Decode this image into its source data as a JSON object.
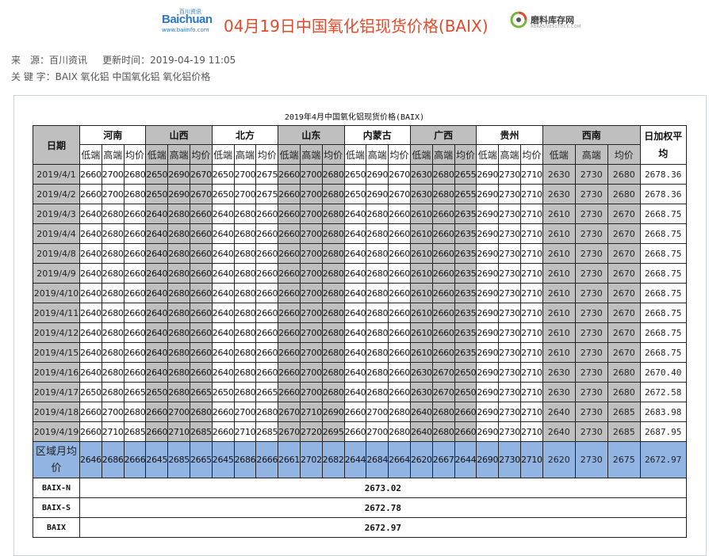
{
  "header": {
    "logo_left": {
      "brand": "Baichuan",
      "top": "百川资讯",
      "sub": "www.baiinfo.com"
    },
    "headline": "04月19日中国氧化铝现货价格(BAIX)",
    "logo_right": {
      "name": "磨料库存网",
      "sub": "ABRASIVESSTOCK.COM"
    }
  },
  "meta": {
    "source_label": "来　源：",
    "source_value": "百川资讯",
    "update_label": "更新时间：",
    "update_value": "2019-04-19 11:05",
    "keywords_label": "关 键 字：",
    "keywords_value": "BAIX 氧化铝 中国氧化铝 氧化铝价格"
  },
  "table": {
    "caption": "2019年4月中国氧化铝现货价格(BAIX)",
    "date_header": "日期",
    "avg_header": "日加权平均",
    "regions": [
      "河南",
      "山西",
      "北方",
      "山东",
      "内蒙古",
      "广西",
      "贵州",
      "西南"
    ],
    "sub_headers": [
      "低端",
      "高端",
      "均价"
    ],
    "rows": [
      {
        "date": "2019/4/1",
        "v": [
          "2660",
          "2700",
          "2680",
          "2650",
          "2690",
          "2670",
          "2650",
          "2700",
          "2675",
          "2660",
          "2700",
          "2680",
          "2650",
          "2690",
          "2670",
          "2630",
          "2680",
          "2655",
          "2690",
          "2730",
          "2710",
          "2630",
          "2730",
          "2680"
        ],
        "avg": "2678.36"
      },
      {
        "date": "2019/4/2",
        "v": [
          "2660",
          "2700",
          "2680",
          "2650",
          "2690",
          "2670",
          "2650",
          "2700",
          "2675",
          "2660",
          "2700",
          "2680",
          "2650",
          "2690",
          "2670",
          "2630",
          "2680",
          "2655",
          "2690",
          "2730",
          "2710",
          "2630",
          "2730",
          "2680"
        ],
        "avg": "2678.36"
      },
      {
        "date": "2019/4/3",
        "v": [
          "2640",
          "2680",
          "2660",
          "2640",
          "2680",
          "2660",
          "2640",
          "2680",
          "2660",
          "2660",
          "2700",
          "2680",
          "2640",
          "2680",
          "2660",
          "2610",
          "2660",
          "2635",
          "2690",
          "2730",
          "2710",
          "2610",
          "2730",
          "2670"
        ],
        "avg": "2668.75"
      },
      {
        "date": "2019/4/4",
        "v": [
          "2640",
          "2680",
          "2660",
          "2640",
          "2680",
          "2660",
          "2640",
          "2680",
          "2660",
          "2660",
          "2700",
          "2680",
          "2640",
          "2680",
          "2660",
          "2610",
          "2660",
          "2635",
          "2690",
          "2730",
          "2710",
          "2610",
          "2730",
          "2670"
        ],
        "avg": "2668.75"
      },
      {
        "date": "2019/4/8",
        "v": [
          "2640",
          "2680",
          "2660",
          "2640",
          "2680",
          "2660",
          "2640",
          "2680",
          "2660",
          "2660",
          "2700",
          "2680",
          "2640",
          "2680",
          "2660",
          "2610",
          "2660",
          "2635",
          "2690",
          "2730",
          "2710",
          "2610",
          "2730",
          "2670"
        ],
        "avg": "2668.75"
      },
      {
        "date": "2019/4/9",
        "v": [
          "2640",
          "2680",
          "2660",
          "2640",
          "2680",
          "2660",
          "2640",
          "2680",
          "2660",
          "2660",
          "2700",
          "2680",
          "2640",
          "2680",
          "2660",
          "2610",
          "2660",
          "2635",
          "2690",
          "2730",
          "2710",
          "2610",
          "2730",
          "2670"
        ],
        "avg": "2668.75"
      },
      {
        "date": "2019/4/10",
        "v": [
          "2640",
          "2680",
          "2660",
          "2640",
          "2680",
          "2660",
          "2640",
          "2680",
          "2660",
          "2660",
          "2700",
          "2680",
          "2640",
          "2680",
          "2660",
          "2610",
          "2660",
          "2635",
          "2690",
          "2730",
          "2710",
          "2610",
          "2730",
          "2670"
        ],
        "avg": "2668.75"
      },
      {
        "date": "2019/4/11",
        "v": [
          "2640",
          "2680",
          "2660",
          "2640",
          "2680",
          "2660",
          "2640",
          "2680",
          "2660",
          "2660",
          "2700",
          "2680",
          "2640",
          "2680",
          "2660",
          "2610",
          "2660",
          "2635",
          "2690",
          "2730",
          "2710",
          "2610",
          "2730",
          "2670"
        ],
        "avg": "2668.75"
      },
      {
        "date": "2019/4/12",
        "v": [
          "2640",
          "2680",
          "2660",
          "2640",
          "2680",
          "2660",
          "2640",
          "2680",
          "2660",
          "2660",
          "2700",
          "2680",
          "2640",
          "2680",
          "2660",
          "2610",
          "2660",
          "2635",
          "2690",
          "2730",
          "2710",
          "2610",
          "2730",
          "2670"
        ],
        "avg": "2668.75"
      },
      {
        "date": "2019/4/15",
        "v": [
          "2640",
          "2680",
          "2660",
          "2640",
          "2680",
          "2660",
          "2640",
          "2680",
          "2660",
          "2660",
          "2700",
          "2680",
          "2640",
          "2680",
          "2660",
          "2610",
          "2660",
          "2635",
          "2690",
          "2730",
          "2710",
          "2610",
          "2730",
          "2670"
        ],
        "avg": "2668.75"
      },
      {
        "date": "2019/4/16",
        "v": [
          "2640",
          "2680",
          "2660",
          "2640",
          "2680",
          "2660",
          "2640",
          "2680",
          "2660",
          "2660",
          "2700",
          "2680",
          "2640",
          "2680",
          "2660",
          "2630",
          "2670",
          "2650",
          "2690",
          "2730",
          "2710",
          "2630",
          "2730",
          "2680"
        ],
        "avg": "2670.40"
      },
      {
        "date": "2019/4/17",
        "v": [
          "2650",
          "2680",
          "2665",
          "2650",
          "2680",
          "2665",
          "2650",
          "2680",
          "2665",
          "2660",
          "2700",
          "2680",
          "2640",
          "2680",
          "2660",
          "2630",
          "2670",
          "2650",
          "2690",
          "2730",
          "2710",
          "2630",
          "2730",
          "2680"
        ],
        "avg": "2672.58"
      },
      {
        "date": "2019/4/18",
        "v": [
          "2660",
          "2700",
          "2680",
          "2660",
          "2700",
          "2680",
          "2660",
          "2700",
          "2680",
          "2670",
          "2710",
          "2690",
          "2660",
          "2700",
          "2680",
          "2640",
          "2680",
          "2660",
          "2690",
          "2730",
          "2710",
          "2640",
          "2730",
          "2685"
        ],
        "avg": "2683.98"
      },
      {
        "date": "2019/4/19",
        "v": [
          "2660",
          "2710",
          "2685",
          "2660",
          "2710",
          "2685",
          "2660",
          "2710",
          "2685",
          "2670",
          "2720",
          "2695",
          "2660",
          "2700",
          "2680",
          "2640",
          "2680",
          "2660",
          "2690",
          "2730",
          "2710",
          "2640",
          "2730",
          "2685"
        ],
        "avg": "2687.95"
      }
    ],
    "month_avg": {
      "label": "区域月均价",
      "v": [
        "2646",
        "2686",
        "2666",
        "2645",
        "2685",
        "2665",
        "2645",
        "2686",
        "2666",
        "2661",
        "2702",
        "2682",
        "2644",
        "2684",
        "2664",
        "2620",
        "2667",
        "2644",
        "2690",
        "2730",
        "2710",
        "2620",
        "2730",
        "2675"
      ],
      "avg": "2672.97"
    },
    "baix": [
      {
        "label": "BAIX-N",
        "value": "2673.02"
      },
      {
        "label": "BAIX-S",
        "value": "2672.78"
      },
      {
        "label": "BAIX",
        "value": "2672.97"
      }
    ]
  },
  "colors": {
    "headline": "#e24a2c",
    "grey_cell": "#bfbfbf",
    "month_row": "#92b4e3",
    "brand_blue": "#2b78c6"
  }
}
